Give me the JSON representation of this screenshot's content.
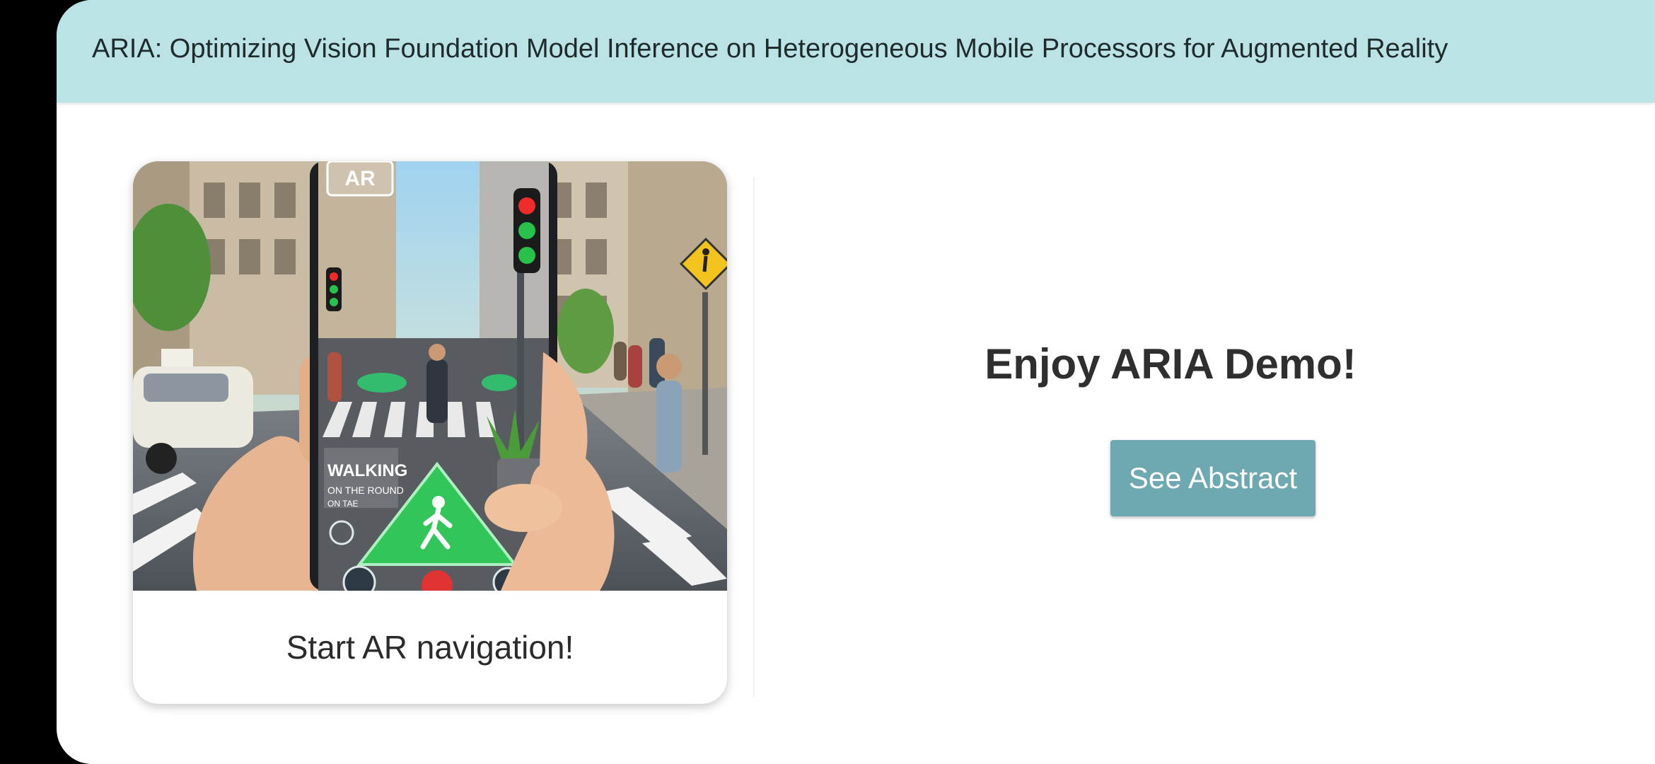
{
  "app": {
    "title": "ARIA: Optimizing Vision Foundation Model Inference on Heterogeneous Mobile Processors for Augmented Reality"
  },
  "card": {
    "image_signs": {
      "ar_badge": "AR",
      "overlay_line1": "WALKING",
      "overlay_line2": "ON THE ROUND",
      "overlay_line3": "ON TAE"
    },
    "label": "Start AR navigation!"
  },
  "hero": {
    "heading": "Enjoy ARIA Demo!",
    "button_label": "See Abstract"
  },
  "colors": {
    "appbar": "#bbe3e5",
    "button": "#6ea8b1",
    "nav_green": "#22c55e"
  },
  "icons": [
    "walking-person-icon",
    "traffic-light-icon",
    "pedestrian-sign-icon"
  ]
}
